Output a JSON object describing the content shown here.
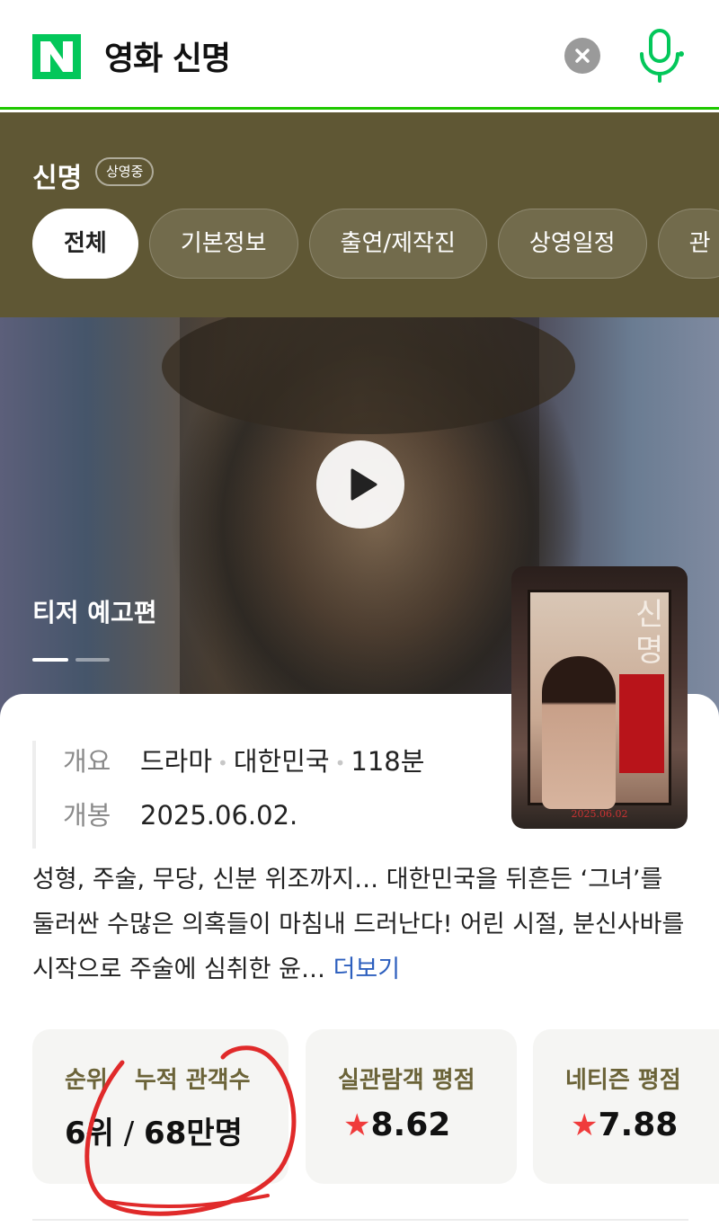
{
  "search": {
    "query": "영화 신명",
    "clear_icon": "close-icon",
    "mic_icon": "microphone-icon",
    "logo": "N",
    "accent": "#1ec800"
  },
  "movie": {
    "title": "신명",
    "status_badge": "상영중",
    "header_bg": "#5f5734"
  },
  "tabs": [
    {
      "label": "전체",
      "active": true
    },
    {
      "label": "기본정보"
    },
    {
      "label": "출연/제작진"
    },
    {
      "label": "상영일정"
    },
    {
      "label": "관"
    }
  ],
  "trailer": {
    "label": "티저 예고편",
    "play_icon": "play-icon",
    "slide_index": 1,
    "slide_count": 2
  },
  "poster": {
    "title_text": "신명",
    "date_text": "2025.06.02"
  },
  "info": {
    "summary_key": "개요",
    "genre": "드라마",
    "country": "대한민국",
    "runtime": "118분",
    "release_key": "개봉",
    "release_date": "2025.06.02."
  },
  "synopsis": {
    "text": "성형, 주술, 무당, 신분 위조까지… 대한민국을 뒤흔든 ‘그녀’를 둘러싼 수많은 의혹들이 마침내 드러난다! 어린 시절, 분신사바를 시작으로 주술에 심취한 윤…",
    "more_label": "더보기",
    "link_color": "#2d5fbe"
  },
  "stats": {
    "rank_label": "순위",
    "audience_label": "누적 관객수",
    "rank_value": "6위",
    "separator": "/",
    "audience_value": "68만명",
    "real_rating_label": "실관람객 평점",
    "real_rating_value": "8.62",
    "netizen_rating_label": "네티즌 평점",
    "netizen_rating_value": "7.88",
    "star_icon": "star-icon",
    "star_color": "#f03b3b"
  }
}
